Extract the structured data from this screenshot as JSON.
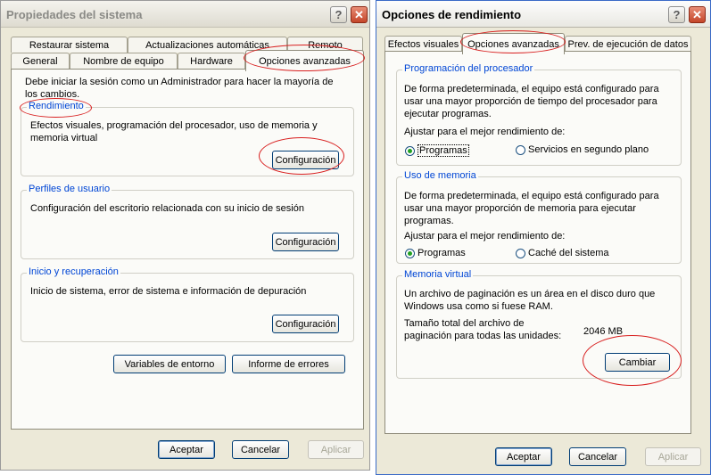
{
  "left_window": {
    "title": "Propiedades del sistema",
    "tabs_back": [
      "Restaurar sistema",
      "Actualizaciones automáticas",
      "Remoto"
    ],
    "tabs_front": [
      "General",
      "Nombre de equipo",
      "Hardware",
      "Opciones avanzadas"
    ],
    "active_tab": "Opciones avanzadas",
    "intro_text": "Debe iniciar la sesión como un Administrador para hacer la mayoría de los cambios.",
    "groups": [
      {
        "title": "Rendimiento",
        "description": "Efectos visuales, programación del procesador, uso de memoria y memoria virtual",
        "button": "Configuración"
      },
      {
        "title": "Perfiles de usuario",
        "description": "Configuración del escritorio relacionada con su inicio de sesión",
        "button": "Configuración"
      },
      {
        "title": "Inicio y recuperación",
        "description": "Inicio de sistema, error de sistema e información de depuración",
        "button": "Configuración"
      }
    ],
    "env_button": "Variables de entorno",
    "errors_button": "Informe de errores",
    "footer": {
      "ok": "Aceptar",
      "cancel": "Cancelar",
      "apply": "Aplicar"
    }
  },
  "right_window": {
    "title": "Opciones de rendimiento",
    "tabs": [
      "Efectos visuales",
      "Opciones avanzadas",
      "Prev. de ejecución de datos"
    ],
    "active_tab": "Opciones avanzadas",
    "processor": {
      "title": "Programación del procesador",
      "description": "De forma predeterminada, el equipo está configurado para usar una mayor proporción de tiempo del procesador para ejecutar programas.",
      "adjust_label": "Ajustar para el mejor rendimiento de:",
      "options": [
        "Programas",
        "Servicios en segundo plano"
      ],
      "selected": "Programas"
    },
    "memory": {
      "title": "Uso de memoria",
      "description": "De forma predeterminada, el equipo está configurado para usar una mayor proporción de memoria para ejecutar programas.",
      "adjust_label": "Ajustar para el mejor rendimiento de:",
      "options": [
        "Programas",
        "Caché del sistema"
      ],
      "selected": "Programas"
    },
    "virtual_memory": {
      "title": "Memoria virtual",
      "description": "Un archivo de paginación es un área en el disco duro que Windows usa como si fuese RAM.",
      "size_label": "Tamaño total del archivo de paginación para todas las unidades:",
      "size_value": "2046 MB",
      "change_button": "Cambiar"
    },
    "footer": {
      "ok": "Aceptar",
      "cancel": "Cancelar",
      "apply": "Aplicar"
    }
  },
  "colors": {
    "annotation": "#d81f1f",
    "group_title": "#0046d5",
    "dialog_bg": "#ece9d8",
    "panel_bg": "#fbfbf8"
  }
}
